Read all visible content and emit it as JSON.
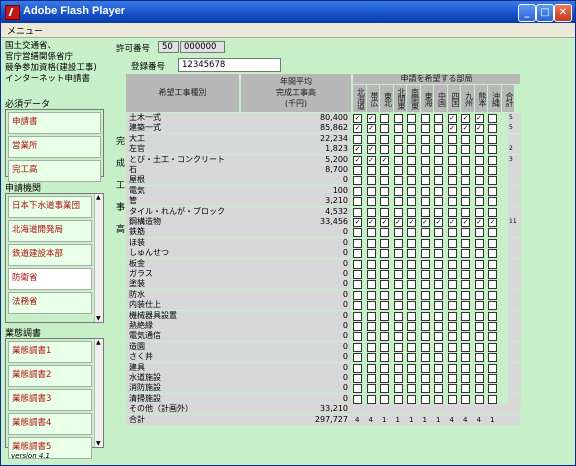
{
  "window": {
    "title": "Adobe Flash Player"
  },
  "menubar": {
    "menu": "メニュー"
  },
  "organization": {
    "line1": "国土交通省、",
    "line2": "官庁営繕関係省庁",
    "line3": "競争参加資格(建設工事)",
    "line4": "インターネット申請書"
  },
  "permit": {
    "label": "許可番号",
    "value1": "50",
    "value2": "000000"
  },
  "registration": {
    "label": "登録番号",
    "value": "12345678"
  },
  "required_data": {
    "header": "必須データ",
    "items": [
      "申請書",
      "営業所",
      "完工高"
    ]
  },
  "agencies": {
    "header": "申請機関",
    "items": [
      "日本下水道事業団",
      "北海道開発局",
      "鉄道建設本部",
      "防衛省",
      "法務省"
    ],
    "selected": 3
  },
  "business_forms": {
    "header": "業態調書",
    "items": [
      "業態調書1",
      "業態調書2",
      "業態調書3",
      "業態調書4",
      "業態調書5"
    ]
  },
  "version": "version 4.1",
  "table": {
    "col_kind": "希望工事種別",
    "col_avg": "年間平均\n完成工事高\n(千円)",
    "col_regions": "申請を希望する部局",
    "side_label": [
      "完",
      "成",
      "工",
      "事",
      "高"
    ],
    "regions": [
      "北海道",
      "帯広",
      "東北",
      "北関東",
      "南関東",
      "東海",
      "中国",
      "四国",
      "九州",
      "熊本",
      "沖縄",
      "合計"
    ],
    "rows": [
      {
        "name": "土木一式",
        "value": "80,400",
        "checks": [
          1,
          1,
          0,
          0,
          0,
          0,
          0,
          1,
          1,
          1,
          0
        ],
        "total": "5"
      },
      {
        "name": "建築一式",
        "value": "85,862",
        "checks": [
          1,
          1,
          0,
          0,
          0,
          0,
          0,
          1,
          1,
          1,
          0
        ],
        "total": "5"
      },
      {
        "name": "大工",
        "value": "22,234",
        "checks": [
          0,
          0,
          0,
          0,
          0,
          0,
          0,
          0,
          0,
          0,
          0
        ],
        "total": ""
      },
      {
        "name": "左官",
        "value": "1,823",
        "checks": [
          1,
          1,
          0,
          0,
          0,
          0,
          0,
          0,
          0,
          0,
          0
        ],
        "total": "2"
      },
      {
        "name": "とび・土工・コンクリート",
        "value": "5,200",
        "checks": [
          1,
          1,
          1,
          0,
          0,
          0,
          0,
          0,
          0,
          0,
          0
        ],
        "total": "3"
      },
      {
        "name": "石",
        "value": "8,700",
        "checks": [
          0,
          0,
          0,
          0,
          0,
          0,
          0,
          0,
          0,
          0,
          0
        ],
        "total": ""
      },
      {
        "name": "屋根",
        "value": "0",
        "checks": [
          0,
          0,
          0,
          0,
          0,
          0,
          0,
          0,
          0,
          0,
          0
        ],
        "total": ""
      },
      {
        "name": "電気",
        "value": "100",
        "checks": [
          0,
          0,
          0,
          0,
          0,
          0,
          0,
          0,
          0,
          0,
          0
        ],
        "total": ""
      },
      {
        "name": "管",
        "value": "3,210",
        "checks": [
          0,
          0,
          0,
          0,
          0,
          0,
          0,
          0,
          0,
          0,
          0
        ],
        "total": ""
      },
      {
        "name": "タイル・れんが・ブロック",
        "value": "4,532",
        "checks": [
          0,
          0,
          0,
          0,
          0,
          0,
          0,
          0,
          0,
          0,
          0
        ],
        "total": ""
      },
      {
        "name": "鋼構造物",
        "value": "33,456",
        "checks": [
          1,
          1,
          1,
          1,
          1,
          1,
          1,
          1,
          1,
          1,
          1
        ],
        "total": "11"
      },
      {
        "name": "鉄筋",
        "value": "0",
        "checks": [
          0,
          0,
          0,
          0,
          0,
          0,
          0,
          0,
          0,
          0,
          0
        ],
        "total": ""
      },
      {
        "name": "ほ装",
        "value": "0",
        "checks": [
          0,
          0,
          0,
          0,
          0,
          0,
          0,
          0,
          0,
          0,
          0
        ],
        "total": ""
      },
      {
        "name": "しゅんせつ",
        "value": "0",
        "checks": [
          0,
          0,
          0,
          0,
          0,
          0,
          0,
          0,
          0,
          0,
          0
        ],
        "total": ""
      },
      {
        "name": "板金",
        "value": "0",
        "checks": [
          0,
          0,
          0,
          0,
          0,
          0,
          0,
          0,
          0,
          0,
          0
        ],
        "total": ""
      },
      {
        "name": "ガラス",
        "value": "0",
        "checks": [
          0,
          0,
          0,
          0,
          0,
          0,
          0,
          0,
          0,
          0,
          0
        ],
        "total": ""
      },
      {
        "name": "塗装",
        "value": "0",
        "checks": [
          0,
          0,
          0,
          0,
          0,
          0,
          0,
          0,
          0,
          0,
          0
        ],
        "total": ""
      },
      {
        "name": "防水",
        "value": "0",
        "checks": [
          0,
          0,
          0,
          0,
          0,
          0,
          0,
          0,
          0,
          0,
          0
        ],
        "total": ""
      },
      {
        "name": "内装仕上",
        "value": "0",
        "checks": [
          0,
          0,
          0,
          0,
          0,
          0,
          0,
          0,
          0,
          0,
          0
        ],
        "total": ""
      },
      {
        "name": "機械器具設置",
        "value": "0",
        "checks": [
          0,
          0,
          0,
          0,
          0,
          0,
          0,
          0,
          0,
          0,
          0
        ],
        "total": ""
      },
      {
        "name": "熱絶縁",
        "value": "0",
        "checks": [
          0,
          0,
          0,
          0,
          0,
          0,
          0,
          0,
          0,
          0,
          0
        ],
        "total": ""
      },
      {
        "name": "電気通信",
        "value": "0",
        "checks": [
          0,
          0,
          0,
          0,
          0,
          0,
          0,
          0,
          0,
          0,
          0
        ],
        "total": ""
      },
      {
        "name": "造園",
        "value": "0",
        "checks": [
          0,
          0,
          0,
          0,
          0,
          0,
          0,
          0,
          0,
          0,
          0
        ],
        "total": ""
      },
      {
        "name": "さく井",
        "value": "0",
        "checks": [
          0,
          0,
          0,
          0,
          0,
          0,
          0,
          0,
          0,
          0,
          0
        ],
        "total": ""
      },
      {
        "name": "建具",
        "value": "0",
        "checks": [
          0,
          0,
          0,
          0,
          0,
          0,
          0,
          0,
          0,
          0,
          0
        ],
        "total": ""
      },
      {
        "name": "水道施設",
        "value": "0",
        "checks": [
          0,
          0,
          0,
          0,
          0,
          0,
          0,
          0,
          0,
          0,
          0
        ],
        "total": ""
      },
      {
        "name": "消防施設",
        "value": "0",
        "checks": [
          0,
          0,
          0,
          0,
          0,
          0,
          0,
          0,
          0,
          0,
          0
        ],
        "total": ""
      },
      {
        "name": "清掃施設",
        "value": "0",
        "checks": [
          0,
          0,
          0,
          0,
          0,
          0,
          0,
          0,
          0,
          0,
          0
        ],
        "total": ""
      }
    ],
    "other": {
      "name": "その他（計画外）",
      "value": "33,210"
    },
    "total": {
      "name": "合計",
      "value": "297,727",
      "counts": [
        "4",
        "4",
        "1",
        "1",
        "1",
        "1",
        "1",
        "4",
        "4",
        "4",
        "1"
      ]
    }
  }
}
